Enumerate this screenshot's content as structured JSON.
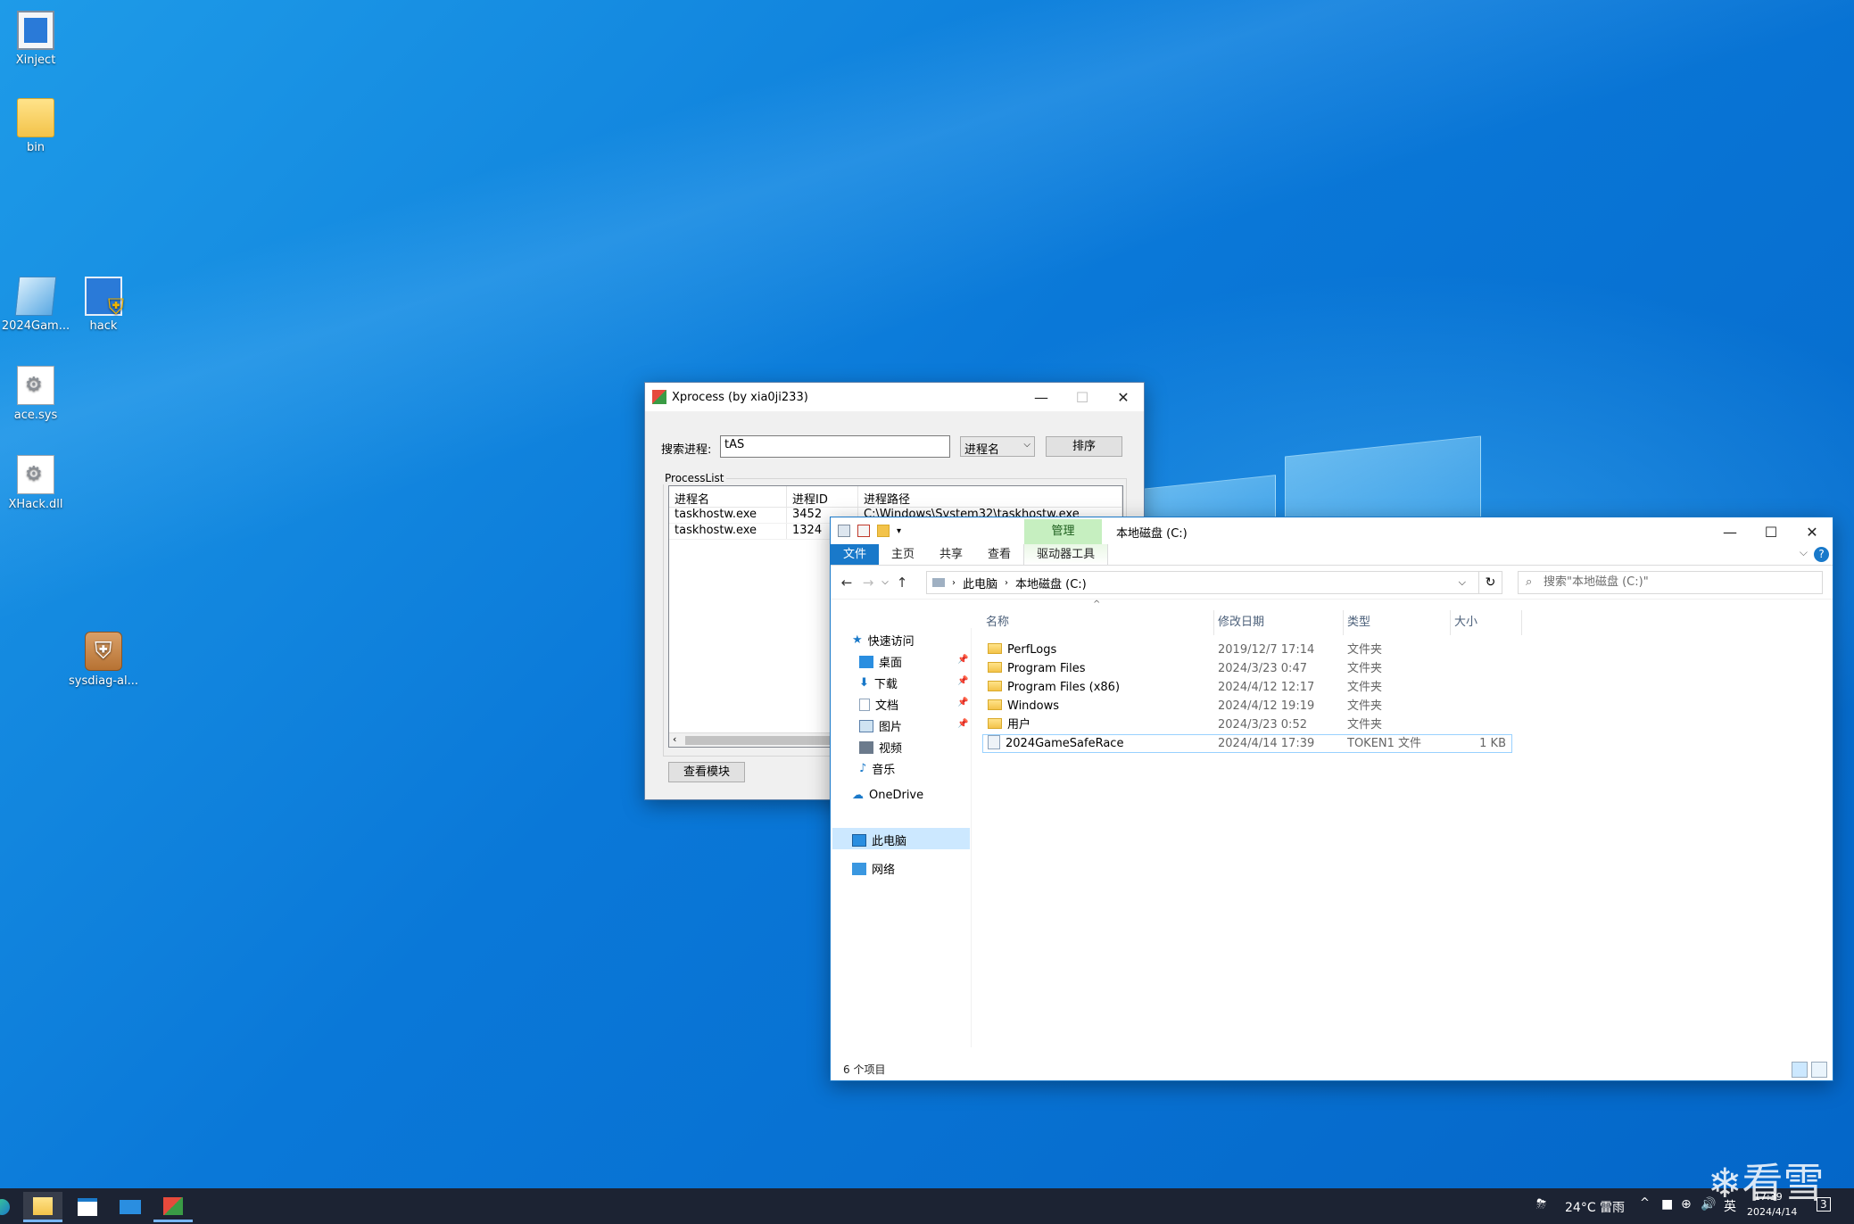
{
  "desktop": {
    "icons": [
      {
        "label": "Xinject",
        "icon": "window-app-icon"
      },
      {
        "label": "bin",
        "icon": "folder-icon"
      },
      {
        "label": "2024Gam...",
        "icon": "notepad-file-icon"
      },
      {
        "label": "hack",
        "icon": "shield-app-icon"
      },
      {
        "label": "ace.sys",
        "icon": "system-file-icon"
      },
      {
        "label": "XHack.dll",
        "icon": "dll-file-icon"
      },
      {
        "label": "sysdiag-al...",
        "icon": "installer-icon"
      }
    ]
  },
  "xprocess": {
    "title": "Xprocess (by xia0ji233)",
    "search_label": "搜索进程:",
    "search_value": "tAS",
    "sort_select": "进程名",
    "sort_button": "排序",
    "group_label": "ProcessList",
    "columns": [
      "进程名",
      "进程ID",
      "进程路径"
    ],
    "rows": [
      {
        "name": "taskhostw.exe",
        "pid": "3452",
        "path": "C:\\Windows\\System32\\taskhostw.exe"
      },
      {
        "name": "taskhostw.exe",
        "pid": "1324",
        "path": ""
      }
    ],
    "view_module_button": "查看模块"
  },
  "explorer": {
    "context_tab": "管理",
    "title": "本地磁盘 (C:)",
    "ribbon_tabs": [
      "文件",
      "主页",
      "共享",
      "查看",
      "驱动器工具"
    ],
    "breadcrumb": [
      "此电脑",
      "本地磁盘 (C:)"
    ],
    "search_placeholder": "搜索\"本地磁盘 (C:)\"",
    "nav": {
      "quick_access": "快速访问",
      "items": [
        "桌面",
        "下载",
        "文档",
        "图片",
        "视频",
        "音乐"
      ],
      "onedrive": "OneDrive",
      "this_pc": "此电脑",
      "network": "网络"
    },
    "columns": [
      "名称",
      "修改日期",
      "类型",
      "大小"
    ],
    "files": [
      {
        "name": "PerfLogs",
        "date": "2019/12/7 17:14",
        "type": "文件夹",
        "size": "",
        "kind": "folder"
      },
      {
        "name": "Program Files",
        "date": "2024/3/23 0:47",
        "type": "文件夹",
        "size": "",
        "kind": "folder"
      },
      {
        "name": "Program Files (x86)",
        "date": "2024/4/12 12:17",
        "type": "文件夹",
        "size": "",
        "kind": "folder"
      },
      {
        "name": "Windows",
        "date": "2024/4/12 19:19",
        "type": "文件夹",
        "size": "",
        "kind": "folder"
      },
      {
        "name": "用户",
        "date": "2024/3/23 0:52",
        "type": "文件夹",
        "size": "",
        "kind": "folder"
      },
      {
        "name": "2024GameSafeRace",
        "date": "2024/4/14 17:39",
        "type": "TOKEN1 文件",
        "size": "1 KB",
        "kind": "file"
      }
    ],
    "status": "6 个项目"
  },
  "taskbar": {
    "weather": "24°C 雷雨",
    "ime": "英",
    "time": "17:39",
    "date": "2024/4/14",
    "notification_count": "3"
  },
  "watermark": "看雪"
}
